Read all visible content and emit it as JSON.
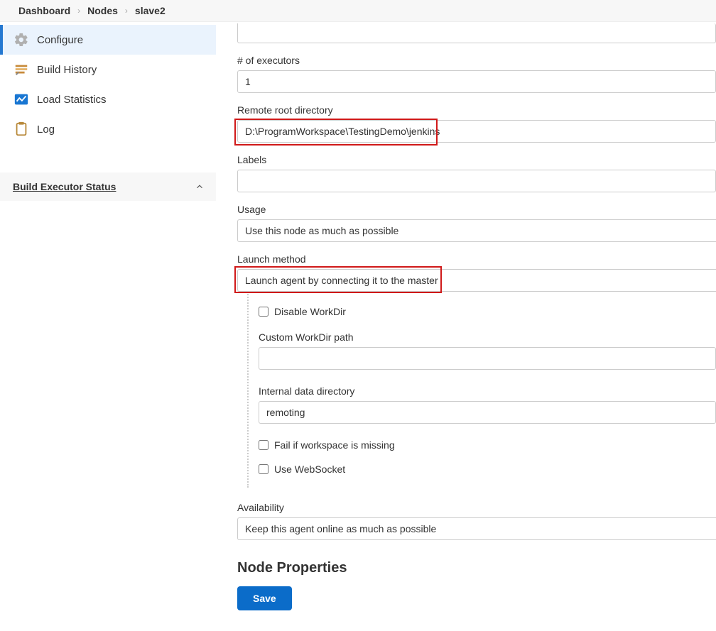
{
  "breadcrumbs": [
    "Dashboard",
    "Nodes",
    "slave2"
  ],
  "sidebar": {
    "items": [
      {
        "label": "Configure",
        "active": true,
        "icon": "gear-icon"
      },
      {
        "label": "Build History",
        "active": false,
        "icon": "history-icon"
      },
      {
        "label": "Load Statistics",
        "active": false,
        "icon": "stats-icon"
      },
      {
        "label": "Log",
        "active": false,
        "icon": "clipboard-icon"
      }
    ],
    "executor_header": "Build Executor Status"
  },
  "form": {
    "executors": {
      "label": "# of executors",
      "value": "1"
    },
    "remote_root": {
      "label": "Remote root directory",
      "value": "D:\\ProgramWorkspace\\TestingDemo\\jenkins"
    },
    "labels": {
      "label": "Labels",
      "value": ""
    },
    "usage": {
      "label": "Usage",
      "value": "Use this node as much as possible"
    },
    "launch": {
      "label": "Launch method",
      "value": "Launch agent by connecting it to the master"
    },
    "disable_workdir": {
      "label": "Disable WorkDir",
      "checked": false
    },
    "custom_workdir": {
      "label": "Custom WorkDir path",
      "value": ""
    },
    "internal_data": {
      "label": "Internal data directory",
      "value": "remoting"
    },
    "fail_missing": {
      "label": "Fail if workspace is missing",
      "checked": false
    },
    "use_websocket": {
      "label": "Use WebSocket",
      "checked": false
    },
    "availability": {
      "label": "Availability",
      "value": "Keep this agent online as much as possible"
    },
    "node_properties_heading": "Node Properties",
    "save_label": "Save"
  }
}
